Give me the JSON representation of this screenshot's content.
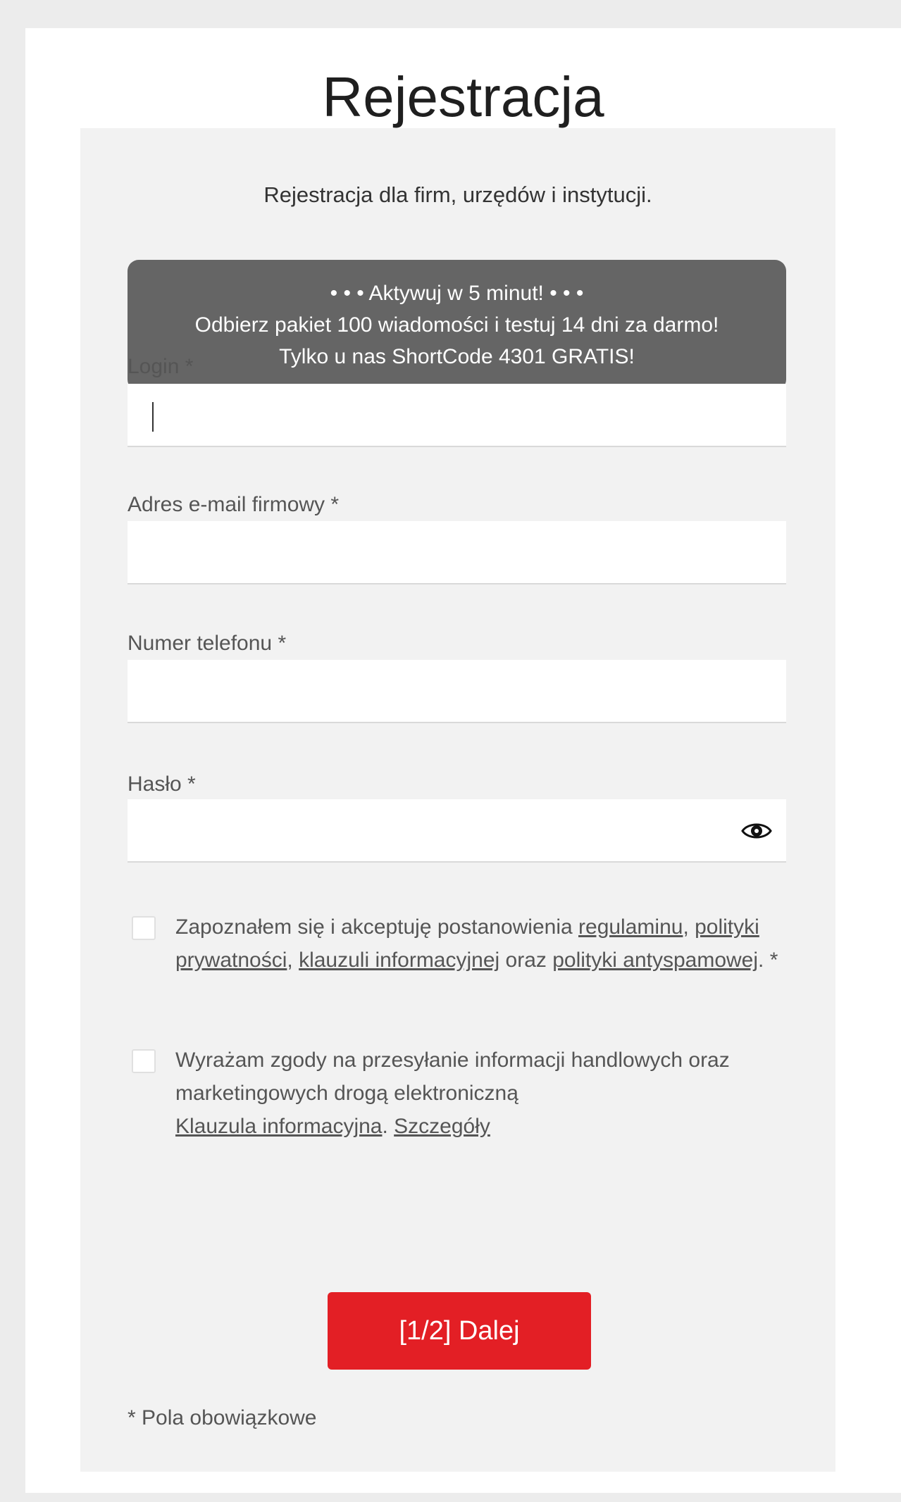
{
  "title": "Rejestracja",
  "subtitle": "Rejestracja dla firm, urzędów i instytucji.",
  "promo": {
    "line1": "• • • Aktywuj w 5 minut! • • •",
    "line2": "Odbierz pakiet 100 wiadomości i testuj 14 dni za darmo!",
    "line3": "Tylko u nas ShortCode 4301 GRATIS!"
  },
  "fields": {
    "login": {
      "label": "Login *",
      "value": ""
    },
    "email": {
      "label": "Adres e-mail firmowy *",
      "value": ""
    },
    "phone": {
      "label": "Numer telefonu *",
      "value": ""
    },
    "password": {
      "label": "Hasło *",
      "value": ""
    }
  },
  "consent_terms": {
    "checked": false,
    "text_1": "Zapoznałem się i akceptuję postanowienia ",
    "link_regulamin": "regulaminu",
    "text_2": ", ",
    "link_privacy": "polityki prywatności",
    "text_3": ", ",
    "link_clause": "klauzuli informacyjnej",
    "text_4": " oraz ",
    "link_antispam": "polityki antyspamowej",
    "text_5": ". *"
  },
  "consent_marketing": {
    "checked": false,
    "text_1": "Wyrażam zgody na przesyłanie informacji handlowych oraz marketingowych drogą elektroniczną",
    "link_clause": "Klauzula informacyjna",
    "text_2": ". ",
    "link_details": "Szczegóły"
  },
  "next_button": "[1/2] Dalej",
  "required_note": "* Pola obowiązkowe",
  "colors": {
    "accent": "#e31f25",
    "promo_bg": "#656565",
    "panel_bg": "#f2f2f2"
  },
  "icons": {
    "password_toggle": "eye-icon"
  }
}
